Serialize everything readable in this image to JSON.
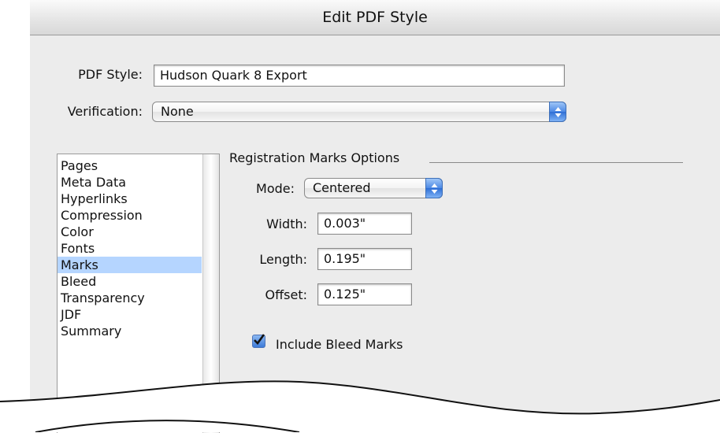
{
  "window": {
    "title": "Edit PDF Style"
  },
  "pdf_style": {
    "label": "PDF Style:",
    "value": "Hudson Quark 8 Export"
  },
  "verification": {
    "label": "Verification:",
    "value": "None"
  },
  "sidebar": {
    "items": [
      {
        "label": "Pages"
      },
      {
        "label": "Meta Data"
      },
      {
        "label": "Hyperlinks"
      },
      {
        "label": "Compression"
      },
      {
        "label": "Color"
      },
      {
        "label": "Fonts"
      },
      {
        "label": "Marks",
        "selected": true
      },
      {
        "label": "Bleed"
      },
      {
        "label": "Transparency"
      },
      {
        "label": "JDF"
      },
      {
        "label": "Summary"
      }
    ]
  },
  "registration": {
    "group_title": "Registration Marks Options",
    "mode": {
      "label": "Mode:",
      "value": "Centered"
    },
    "width": {
      "label": "Width:",
      "value": "0.003\""
    },
    "length": {
      "label": "Length:",
      "value": "0.195\""
    },
    "offset": {
      "label": "Offset:",
      "value": "0.125\""
    },
    "include_bleed": {
      "label": "Include Bleed Marks",
      "checked": true
    }
  },
  "colors": {
    "accent": "#3c7ad8",
    "selection": "#b5d5ff"
  }
}
